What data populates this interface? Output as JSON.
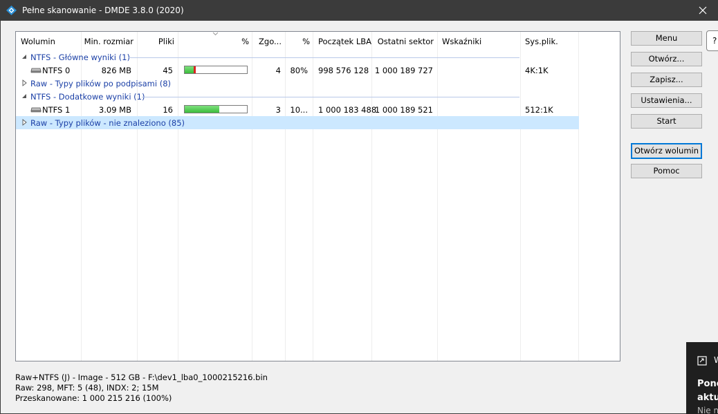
{
  "window": {
    "title": "Pełne skanowanie - DMDE 3.8.0 (2020)"
  },
  "table": {
    "columns": [
      "Wolumin",
      "Min. rozmiar",
      "Pliki",
      "%",
      "Zgo...",
      "%",
      "Początek LBA",
      "Ostatni sektor",
      "Wskaźniki",
      "Sys.plik."
    ],
    "groups": [
      {
        "label": "NTFS - Główne wyniki (1)",
        "expanded": true
      },
      {
        "label": "Raw - Typy plików po podpisami (8)",
        "expanded": false
      },
      {
        "label": "NTFS - Dodatkowe wyniki (1)",
        "expanded": true
      },
      {
        "label": "Raw - Typy plików - nie znaleziono (85)",
        "expanded": false,
        "selected": true
      }
    ],
    "rows": [
      {
        "name": "NTFS 0",
        "size": "826 MB",
        "files": "45",
        "progress": 0.14,
        "marker": 0.14,
        "match": "4",
        "pct": "80%",
        "lba_start": "998 576 128",
        "last_sector": "1 000 189 727",
        "flags": "",
        "fs": "4K:1K"
      },
      {
        "name": "NTFS 1",
        "size": "3.09 MB",
        "files": "16",
        "progress": 0.55,
        "marker": null,
        "match": "3",
        "pct": "10...",
        "lba_start": "1 000 183 488",
        "last_sector": "1 000 189 521",
        "flags": "",
        "fs": "512:1K"
      }
    ]
  },
  "buttons": {
    "menu": "Menu",
    "open": "Otwórz...",
    "save": "Zapisz...",
    "settings": "Ustawienia...",
    "start": "Start",
    "open_volume": "Otwórz wolumin",
    "help": "Pomoc",
    "help_q": "?"
  },
  "status": {
    "line1": "Raw+NTFS (J) - Image - 512 GB - F:\\dev1_lba0_1000215216.bin",
    "line2": "Raw: 298, MFT: 5 (48), INDX: 2; 15M",
    "line3": "Przeskanowane: 1 000 215 216 (100%)"
  },
  "toast": {
    "header": "W",
    "line1": "Ponc",
    "line2": "aktu",
    "line3": "Nie n"
  },
  "colors": {
    "titlebar": "#3b3b3b",
    "group_text": "#1a3fa6",
    "selection": "#cce8ff",
    "progress_fill": "#3cbc3c",
    "progress_marker": "#d22222",
    "default_button_border": "#0078d7"
  }
}
